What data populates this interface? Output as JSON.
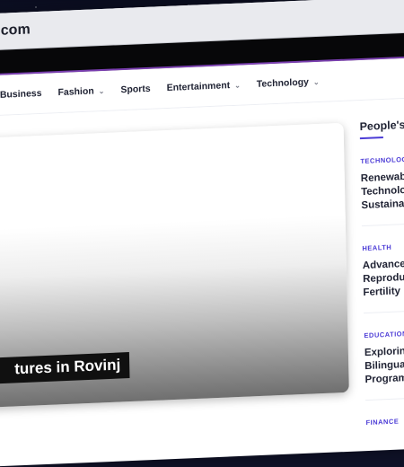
{
  "browser": {
    "url_visible": ".com"
  },
  "nav": {
    "items": [
      {
        "label": "Business",
        "dropdown": false
      },
      {
        "label": "Fashion",
        "dropdown": true
      },
      {
        "label": "Sports",
        "dropdown": false
      },
      {
        "label": "Entertainment",
        "dropdown": true
      },
      {
        "label": "Technology",
        "dropdown": true
      }
    ]
  },
  "hero": {
    "title": "tures in Rovinj"
  },
  "sidebar": {
    "heading": "People's I",
    "items": [
      {
        "category": "TECHNOLOG",
        "lines": [
          "Renewab",
          "Technolo",
          "Sustaina"
        ]
      },
      {
        "category": "HEALTH",
        "lines": [
          "Advance",
          "Reprodu",
          "Fertility"
        ]
      },
      {
        "category": "EDUCATION",
        "lines": [
          "Explorin",
          "Bilingua",
          "Program"
        ]
      },
      {
        "category": "FINANCE",
        "lines": []
      }
    ]
  },
  "colors": {
    "accent": "#4b3bd6",
    "topbar": "#070709",
    "accent_border": "#7a3fb0"
  }
}
